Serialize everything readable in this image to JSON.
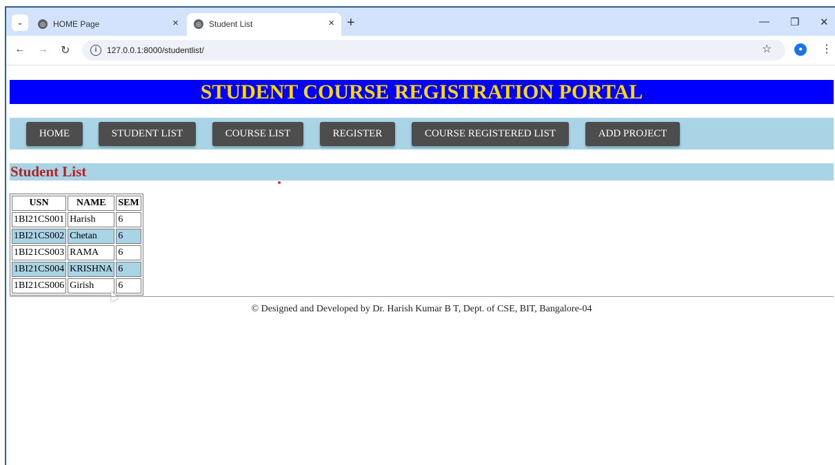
{
  "browser": {
    "tabs": [
      {
        "title": "HOME Page",
        "active": false
      },
      {
        "title": "Student List",
        "active": true
      }
    ],
    "url": "127.0.0.1:8000/studentlist/"
  },
  "page": {
    "banner_title": "STUDENT COURSE REGISTRATION PORTAL",
    "nav": [
      "HOME",
      "STUDENT LIST",
      "COURSE LIST",
      "REGISTER",
      "COURSE REGISTERED LIST",
      "ADD PROJECT"
    ],
    "section_title": "Student List",
    "table": {
      "headers": [
        "USN",
        "NAME",
        "SEM"
      ],
      "rows": [
        [
          "1BI21CS001",
          "Harish",
          "6"
        ],
        [
          "1BI21CS002",
          "Chetan",
          "6"
        ],
        [
          "1BI21CS003",
          "RAMA",
          "6"
        ],
        [
          "1BI21CS004",
          "KRISHNA",
          "6"
        ],
        [
          "1BI21CS006",
          "Girish",
          "6"
        ]
      ]
    },
    "footer": "© Designed and Developed by Dr. Harish Kumar B T, Dept. of CSE, BIT, Bangalore-04"
  },
  "colors": {
    "banner_bg": "#0000ff",
    "banner_text": "#ffd700",
    "nav_bg": "#a8d4e6",
    "nav_button": "#4d4d4d",
    "section_title": "#b22222"
  }
}
